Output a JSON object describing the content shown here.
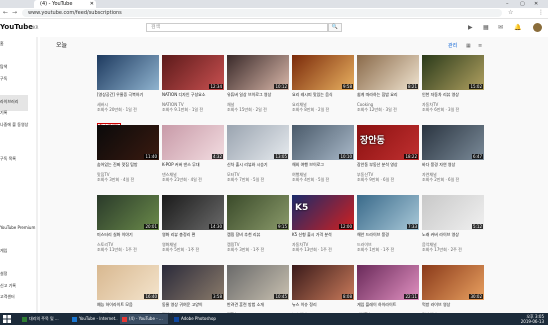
{
  "browser": {
    "tab_title": "(4) - YouTube",
    "url": "www.youtube.com/feed/subscriptions",
    "window_controls": [
      "–",
      "▢",
      "✕"
    ]
  },
  "youtube": {
    "logo_text": "YouTube",
    "logo_region": "KR",
    "search_placeholder": "검색",
    "section_heading": "오늘",
    "links": [
      "관리",
      "▦",
      "≡"
    ]
  },
  "sidebar": {
    "items": [
      "홈",
      "",
      "탐색",
      "구독",
      "",
      "라이브러리",
      "기록",
      "나중에 볼 동영상",
      "",
      "",
      "구독 목록",
      "",
      "",
      "",
      "",
      "",
      "YouTube Premium",
      "",
      "게임",
      "",
      "설정",
      "신고 기록",
      "고객센터"
    ]
  },
  "videos": [
    {
      "title": "[영상공간] 우울증 극복하기",
      "channel": "세바시",
      "meta": "조회수 20만회 · 1일 전",
      "dur": "",
      "colors": [
        "#1e3a5f",
        "#8fb3cf"
      ],
      "caption": "",
      "badge": "최근 업로드"
    },
    {
      "title": "NATION 디자인 구성요소",
      "channel": "NATION TV",
      "meta": "조회수 9.1만회 · 1일 전",
      "dur": "12:34",
      "colors": [
        "#5c1a1a",
        "#c85050"
      ],
      "caption": "",
      "badge": ""
    },
    {
      "title": "유튜버 일상 브이로그 영상",
      "channel": "채널",
      "meta": "조회수 15만회 · 2일 전",
      "dur": "10:12",
      "colors": [
        "#3a2a2a",
        "#d8b6a8"
      ],
      "caption": "",
      "badge": ""
    },
    {
      "title": "요리 레시피 맛있는 음식",
      "channel": "요리채널",
      "meta": "조회수 8만회 · 2일 전",
      "dur": "9:58",
      "colors": [
        "#7a2a0a",
        "#e8b060"
      ],
      "caption": "",
      "badge": ""
    },
    {
      "title": "쉽게 따라하는 집밥 요리",
      "channel": "Cooking",
      "meta": "조회수 12만회 · 3일 전",
      "dur": "8:21",
      "colors": [
        "#8a6a4a",
        "#efe3cf"
      ],
      "caption": "",
      "badge": ""
    },
    {
      "title": "인천 자동차 리뷰 영상",
      "channel": "자동차TV",
      "meta": "조회수 6만회 · 3일 전",
      "dur": "15:02",
      "colors": [
        "#2a3a1a",
        "#b0a060"
      ],
      "caption": "",
      "badge": ""
    },
    {
      "title": "숨어있는 진짜 맛집 탐방",
      "channel": "맛집TV",
      "meta": "조회수 3만회 · 4일 전",
      "dur": "11:40",
      "colors": [
        "#0a0a0a",
        "#3a1a10"
      ],
      "caption": "",
      "badge": ""
    },
    {
      "title": "K-POP 커버 댄스 무대",
      "channel": "댄스채널",
      "meta": "조회수 21만회 · 4일 전",
      "dur": "4:32",
      "colors": [
        "#c89aa8",
        "#f2dce0"
      ],
      "caption": "",
      "badge": ""
    },
    {
      "title": "신차 출시 리뷰와 시승기",
      "channel": "모터TV",
      "meta": "조회수 7만회 · 5일 전",
      "dur": "13:05",
      "colors": [
        "#9aa4b0",
        "#e6eaee"
      ],
      "caption": "",
      "badge": ""
    },
    {
      "title": "해외 여행 브이로그",
      "channel": "여행채널",
      "meta": "조회수 4만회 · 5일 전",
      "dur": "10:10",
      "colors": [
        "#4a5a6a",
        "#a8b8c8"
      ],
      "caption": "",
      "badge": ""
    },
    {
      "title": "장안동 부동산 분석 영상",
      "channel": "부동산TV",
      "meta": "조회수 9만회 · 6일 전",
      "dur": "18:22",
      "colors": [
        "#8a1010",
        "#c03030"
      ],
      "caption": "장안동",
      "badge": ""
    },
    {
      "title": "바다 풍경 자연 영상",
      "channel": "자연채널",
      "meta": "조회수 2만회 · 6일 전",
      "dur": "6:47",
      "colors": [
        "#2a3440",
        "#7a8a98"
      ],
      "caption": "",
      "badge": ""
    },
    {
      "title": "미스터리 실화 이야기",
      "channel": "스토리TV",
      "meta": "조회수 11만회 · 1주 전",
      "dur": "20:01",
      "colors": [
        "#2a3a2a",
        "#6a8a4a"
      ],
      "caption": "",
      "badge": ""
    },
    {
      "title": "영화 리뷰 총정리 편",
      "channel": "영화채널",
      "meta": "조회수 5만회 · 1주 전",
      "dur": "14:30",
      "colors": [
        "#1a1a1a",
        "#6a6a6a"
      ],
      "caption": "",
      "badge": ""
    },
    {
      "title": "캠핑 장비 추천 리뷰",
      "channel": "캠핑TV",
      "meta": "조회수 3만회 · 1주 전",
      "dur": "9:15",
      "colors": [
        "#3a4a2a",
        "#8a9a6a"
      ],
      "caption": "",
      "badge": ""
    },
    {
      "title": "K5 신형 출시 가격 분석",
      "channel": "자동차TV",
      "meta": "조회수 13만회 · 1주 전",
      "dur": "12:00",
      "colors": [
        "#1a2a6a",
        "#d02020"
      ],
      "caption": "K5",
      "badge": ""
    },
    {
      "title": "해안 드라이브 풍경",
      "channel": "드라이브",
      "meta": "조회수 1만회 · 1주 전",
      "dur": "7:33",
      "colors": [
        "#3a6a8a",
        "#a8c8d8"
      ],
      "caption": "",
      "badge": ""
    },
    {
      "title": "노래 커버 라이브 영상",
      "channel": "음악채널",
      "meta": "조회수 17만회 · 2주 전",
      "dur": "5:12",
      "colors": [
        "#c8c8c8",
        "#f0f0f0"
      ],
      "caption": "",
      "badge": ""
    },
    {
      "title": "예능 하이라이트 모음",
      "channel": "예능채널",
      "meta": "조회수 22만회 · 2주 전",
      "dur": "16:40",
      "colors": [
        "#d8b890",
        "#f4e4cc"
      ],
      "caption": "",
      "badge": ""
    },
    {
      "title": "동물 영상 귀여운 고양이",
      "channel": "펫채널",
      "meta": "조회수 8만회 · 2주 전",
      "dur": "3:58",
      "colors": [
        "#2a2a3a",
        "#8a7a6a"
      ],
      "caption": "",
      "badge": ""
    },
    {
      "title": "반려견 훈련 방법 소개",
      "channel": "펫TV",
      "meta": "조회수 6만회 · 2주 전",
      "dur": "10:45",
      "colors": [
        "#6a6a6a",
        "#c8c0b0"
      ],
      "caption": "",
      "badge": ""
    },
    {
      "title": "뉴스 이슈 정리",
      "channel": "뉴스채널",
      "meta": "조회수 10만회 · 2주 전",
      "dur": "8:08",
      "colors": [
        "#3a1a1a",
        "#c87a5a"
      ],
      "caption": "",
      "badge": ""
    },
    {
      "title": "게임 플레이 하이라이트",
      "channel": "게임TV",
      "meta": "조회수 14만회 · 3주 전",
      "dur": "22:11",
      "colors": [
        "#6a2a5a",
        "#e090c0"
      ],
      "caption": "",
      "badge": ""
    },
    {
      "title": "먹방 라이브 영상",
      "channel": "먹방채널",
      "meta": "조회수 19만회 · 3주 전",
      "dur": "30:02",
      "colors": [
        "#8a3a1a",
        "#e8a060"
      ],
      "caption": "",
      "badge": ""
    }
  ],
  "taskbar": {
    "items": [
      {
        "label": "대리의 주목 및 ...",
        "color": "#2e7d32"
      },
      {
        "label": "YouTube - Internet...",
        "color": "#1976d2"
      },
      {
        "label": "(4) - YouTube - ...",
        "color": "#e53935"
      },
      {
        "label": "Adobe Photoshop",
        "color": "#0d47a1"
      }
    ],
    "time": "오후 3:05",
    "date": "2019-06-13"
  }
}
